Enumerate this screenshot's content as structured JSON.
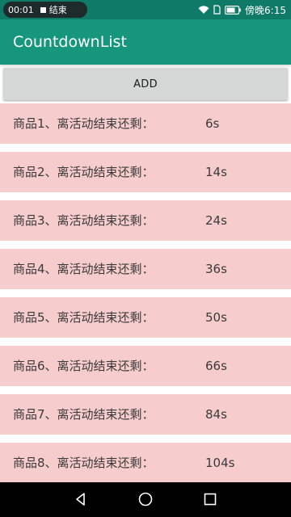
{
  "status_bar": {
    "time_left": "00:01",
    "recording_label": "结束",
    "clock": "傍晚6:15",
    "bg_color": "#0f7a67"
  },
  "app_bar": {
    "title": "CountdownList",
    "bg_color": "#17967e"
  },
  "add_button": {
    "label": "ADD"
  },
  "items": [
    {
      "label": "商品1、离活动结束还剩：",
      "remaining": "6s"
    },
    {
      "label": "商品2、离活动结束还剩：",
      "remaining": "14s"
    },
    {
      "label": "商品3、离活动结束还剩：",
      "remaining": "24s"
    },
    {
      "label": "商品4、离活动结束还剩：",
      "remaining": "36s"
    },
    {
      "label": "商品5、离活动结束还剩：",
      "remaining": "50s"
    },
    {
      "label": "商品6、离活动结束还剩：",
      "remaining": "66s"
    },
    {
      "label": "商品7、离活动结束还剩：",
      "remaining": "84s"
    },
    {
      "label": "商品8、离活动结束还剩：",
      "remaining": "104s"
    }
  ],
  "colors": {
    "item_bg": "#f7cccc",
    "nav_bar": "#000000"
  },
  "icons": {
    "status": [
      "wifi-icon",
      "sim-icon",
      "battery-icon"
    ],
    "nav": [
      "back-icon",
      "home-icon",
      "recents-icon"
    ]
  }
}
